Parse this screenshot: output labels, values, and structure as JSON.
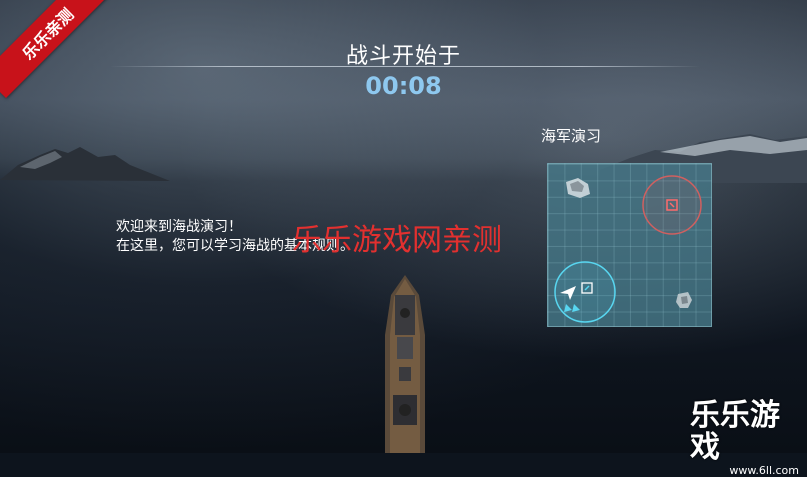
{
  "corner_badge": "乐乐亲测",
  "header": {
    "title": "战斗开始于",
    "countdown": "00:08"
  },
  "tutorial": {
    "line1": "欢迎来到海战演习！",
    "line2": "在这里，您可以学习海战的基本规则。"
  },
  "watermark": "乐乐游戏网亲测",
  "minimap": {
    "title": "海军演习",
    "icons": [
      "ally-capture-zone-icon",
      "enemy-capture-zone-icon",
      "player-ship-icon",
      "rock-icon"
    ],
    "colors": {
      "enemy": "#e05555",
      "ally": "#58d6f0"
    }
  },
  "logo": {
    "main": "乐乐游戏",
    "sub": "www.6ll.com"
  }
}
